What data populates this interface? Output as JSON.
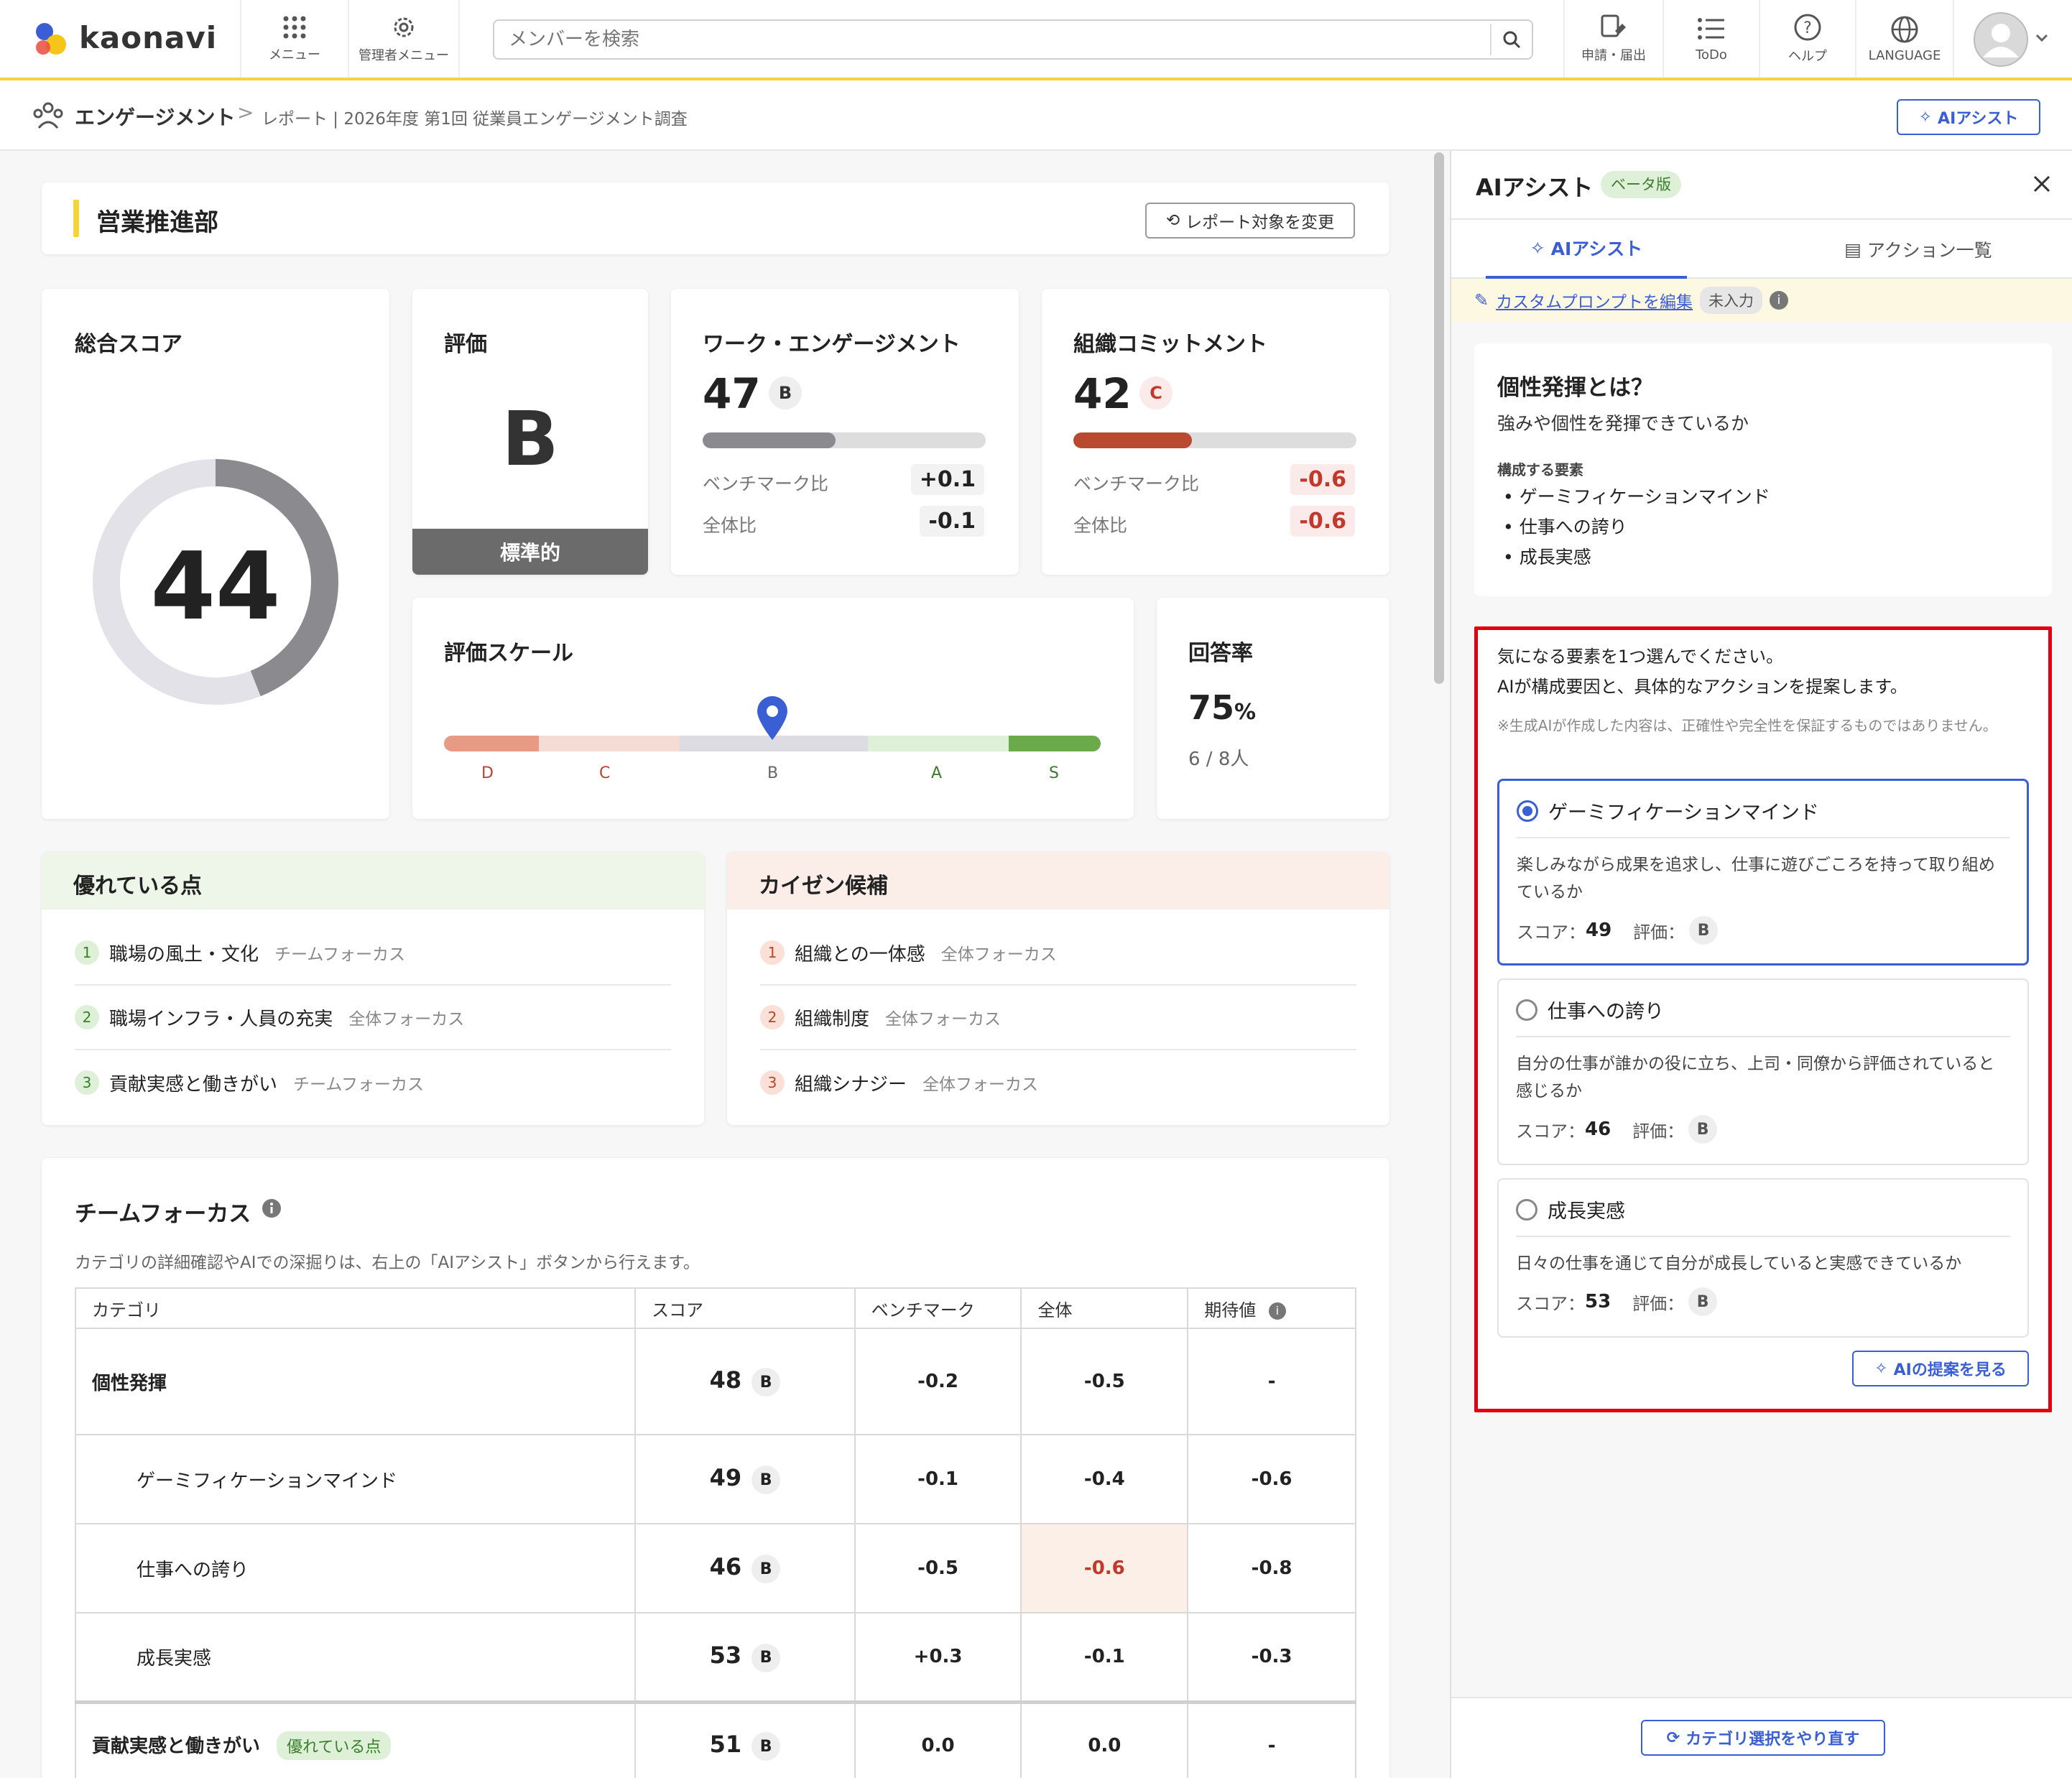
{
  "header": {
    "logo_text": "kaonavi",
    "menu_label": "メニュー",
    "admin_menu_label": "管理者メニュー",
    "search_placeholder": "メンバーを検索",
    "apply_label": "申請・届出",
    "todo_label": "ToDo",
    "help_label": "ヘルプ",
    "language_label": "LANGUAGE"
  },
  "breadcrumb": {
    "section": "エンゲージメント",
    "separator": ">",
    "current": "レポート | 2026年度 第1回 従業員エンゲージメント調査",
    "ai_assist_button": "AIアシスト"
  },
  "dept": {
    "title": "営業推進部",
    "change_button": "レポート対象を変更"
  },
  "summary": {
    "total_title": "総合スコア",
    "total_score": "44",
    "total_fraction": 0.44,
    "rating_title": "評価",
    "rating_grade": "B",
    "rating_label": "標準的",
    "work": {
      "title": "ワーク・エンゲージメント",
      "score": "47",
      "grade": "B",
      "fill": 0.47,
      "bench_label": "ベンチマーク比",
      "bench_value": "+0.1",
      "overall_label": "全体比",
      "overall_value": "-0.1"
    },
    "org": {
      "title": "組織コミットメント",
      "score": "42",
      "grade": "C",
      "fill": 0.42,
      "bench_label": "ベンチマーク比",
      "bench_value": "-0.6",
      "overall_label": "全体比",
      "overall_value": "-0.6"
    },
    "scale": {
      "title": "評価スケール",
      "labels": [
        "D",
        "C",
        "B",
        "A",
        "S"
      ],
      "marker_grade": "B"
    },
    "response": {
      "title": "回答率",
      "rate": "75",
      "unit": "%",
      "count": "6 / 8人"
    }
  },
  "strengths": {
    "title": "優れている点",
    "items": [
      {
        "n": "1",
        "name": "職場の風土・文化",
        "focus": "チームフォーカス"
      },
      {
        "n": "2",
        "name": "職場インフラ・人員の充実",
        "focus": "全体フォーカス"
      },
      {
        "n": "3",
        "name": "貢献実感と働きがい",
        "focus": "チームフォーカス"
      }
    ]
  },
  "kaizen": {
    "title": "カイゼン候補",
    "items": [
      {
        "n": "1",
        "name": "組織との一体感",
        "focus": "全体フォーカス"
      },
      {
        "n": "2",
        "name": "組織制度",
        "focus": "全体フォーカス"
      },
      {
        "n": "3",
        "name": "組織シナジー",
        "focus": "全体フォーカス"
      }
    ]
  },
  "team_focus": {
    "title": "チームフォーカス",
    "description": "カテゴリの詳細確認やAIでの深掘りは、右上の「AIアシスト」ボタンから行えます。",
    "columns": [
      "カテゴリ",
      "スコア",
      "ベンチマーク",
      "全体",
      "期待値"
    ],
    "rows": [
      {
        "name": "個性発揮",
        "score": "48",
        "grade": "B",
        "bench": "-0.2",
        "overall": "-0.5",
        "expect": "-"
      },
      {
        "name": "ゲーミフィケーションマインド",
        "score": "49",
        "grade": "B",
        "bench": "-0.1",
        "overall": "-0.4",
        "expect": "-0.6"
      },
      {
        "name": "仕事への誇り",
        "score": "46",
        "grade": "B",
        "bench": "-0.5",
        "overall": "-0.6",
        "expect": "-0.8"
      },
      {
        "name": "成長実感",
        "score": "53",
        "grade": "B",
        "bench": "+0.3",
        "overall": "-0.1",
        "expect": "-0.3"
      },
      {
        "name": "貢献実感と働きがい",
        "tag": "優れている点",
        "score": "51",
        "grade": "B",
        "bench": "0.0",
        "overall": "0.0",
        "expect": "-"
      }
    ]
  },
  "ai_panel": {
    "title": "AIアシスト",
    "beta": "ベータ版",
    "tab_ai": "AIアシスト",
    "tab_actions": "アクション一覧",
    "custom_prompt": "カスタムプロンプトを編集",
    "custom_status": "未入力",
    "concept_title": "個性発揮とは？",
    "concept_desc": "強みや個性を発揮できているか",
    "elements_label": "構成する要素",
    "elements": [
      "ゲーミフィケーションマインド",
      "仕事への誇り",
      "成長実感"
    ],
    "instruction1": "気になる要素を1つ選んでください。",
    "instruction2": "AIが構成要因と、具体的なアクションを提案します。",
    "disclaimer": "※生成AIが作成した内容は、正確性や完全性を保証するものではありません。",
    "options": [
      {
        "name": "ゲーミフィケーションマインド",
        "desc": "楽しみながら成果を追求し、仕事に遊びごころを持って取り組めているか",
        "score_label": "スコア：",
        "score": "49",
        "grade_label": "評価：",
        "grade": "B",
        "selected": true
      },
      {
        "name": "仕事への誇り",
        "desc": "自分の仕事が誰かの役に立ち、上司・同僚から評価されていると感じるか",
        "score_label": "スコア：",
        "score": "46",
        "grade_label": "評価：",
        "grade": "B",
        "selected": false
      },
      {
        "name": "成長実感",
        "desc": "日々の仕事を通じて自分が成長していると実感できているか",
        "score_label": "スコア：",
        "score": "53",
        "grade_label": "評価：",
        "grade": "B",
        "selected": false
      }
    ],
    "suggest_button": "AIの提案を見る",
    "reset_button": "カテゴリ選択をやり直す"
  },
  "colors": {
    "accent": "#3a5fd4",
    "brand_yellow": "#f5d33c",
    "negative": "#c0392b",
    "highlight_box": "#e0000f"
  }
}
